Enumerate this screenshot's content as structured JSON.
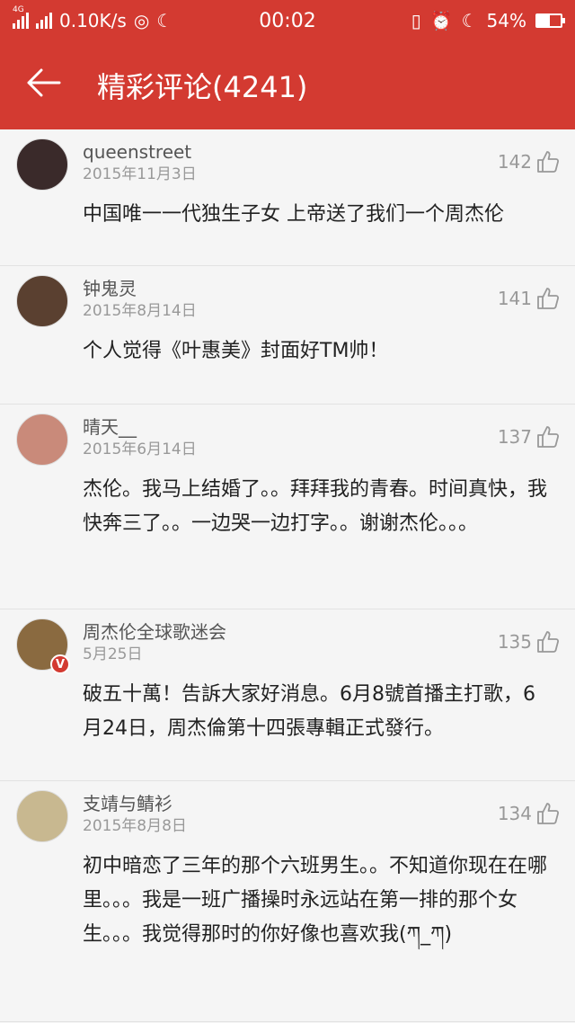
{
  "statusbar": {
    "network_tag": "4G",
    "speed": "0.10K/s",
    "time": "00:02",
    "battery": "54%",
    "battery_level": 0.54
  },
  "header": {
    "title": "精彩评论(4241)"
  },
  "comments": [
    {
      "user": "queenstreet",
      "date": "2015年11月3日",
      "likes": "142",
      "text": "中国唯一一代独生子女 上帝送了我们一个周杰伦",
      "avatar_color": "#3a2a2a"
    },
    {
      "user": "钟鬼灵",
      "date": "2015年8月14日",
      "likes": "141",
      "text": "个人觉得《叶惠美》封面好TM帅！",
      "avatar_color": "#5a4030"
    },
    {
      "user": "晴天__",
      "date": "2015年6月14日",
      "likes": "137",
      "text": "杰伦。我马上结婚了。。拜拜我的青春。时间真快，我快奔三了。。一边哭一边打字。。谢谢杰伦。。。",
      "avatar_color": "#c98a7a"
    },
    {
      "user": "周杰伦全球歌迷会",
      "date": "5月25日",
      "likes": "135",
      "text": "破五十萬！告訴大家好消息。6月8號首播主打歌，6月24日，周杰倫第十四張專輯正式發行。",
      "avatar_color": "#8a6a40",
      "badge": "V"
    },
    {
      "user": "支靖与鲭衫",
      "date": "2015年8月8日",
      "likes": "134",
      "text": "初中暗恋了三年的那个六班男生。。不知道你现在在哪里。。。我是一班广播操时永远站在第一排的那个女生。。。我觉得那时的你好像也喜欢我(ཀ_ཀ)",
      "avatar_color": "#c8b890"
    }
  ],
  "colors": {
    "accent": "#d33a31"
  }
}
